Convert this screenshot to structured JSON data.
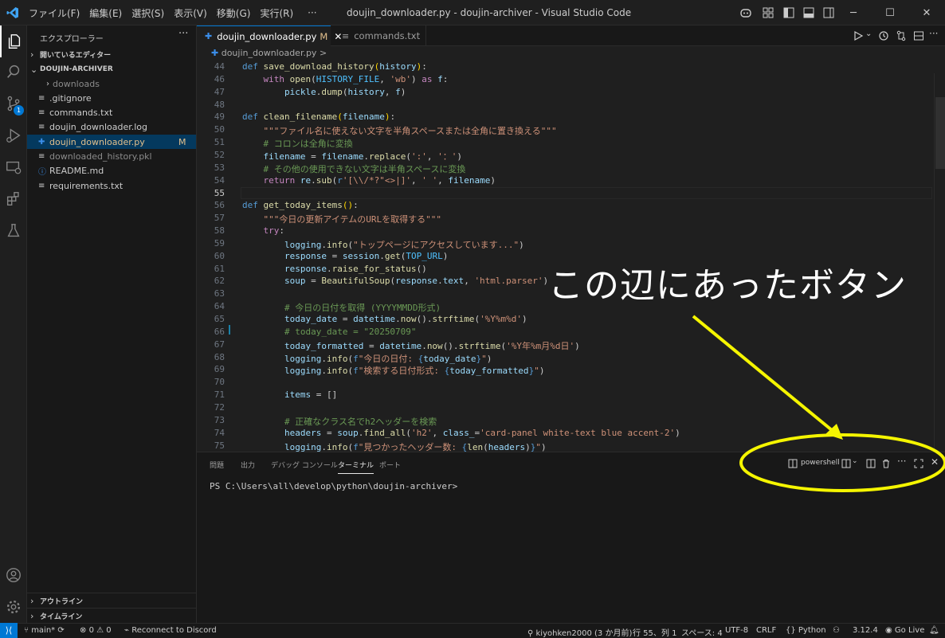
{
  "titlebar": {
    "menu": [
      "ファイル(F)",
      "編集(E)",
      "選択(S)",
      "表示(V)",
      "移動(G)",
      "実行(R)",
      "···"
    ],
    "window_title": "doujin_downloader.py - doujin-archiver - Visual Studio Code"
  },
  "sidebar": {
    "header": "エクスプローラー",
    "open_editors": "開いているエディター",
    "project": "DOUJIN-ARCHIVER",
    "items": [
      {
        "label": "downloads",
        "type": "folder"
      },
      {
        "label": ".gitignore",
        "type": "file"
      },
      {
        "label": "commands.txt",
        "type": "file"
      },
      {
        "label": "doujin_downloader.log",
        "type": "file"
      },
      {
        "label": "doujin_downloader.py",
        "type": "python",
        "selected": true,
        "badge": "M"
      },
      {
        "label": "downloaded_history.pkl",
        "type": "file"
      },
      {
        "label": "README.md",
        "type": "info"
      },
      {
        "label": "requirements.txt",
        "type": "file"
      }
    ],
    "outline": "アウトライン",
    "timeline": "タイムライン"
  },
  "scm_badge": "1",
  "tabs": [
    {
      "label": "doujin_downloader.py",
      "modified": "M",
      "active": true
    },
    {
      "label": "commands.txt",
      "active": false
    }
  ],
  "breadcrumb": "doujin_downloader.py >",
  "code_lines": [
    {
      "n": "44",
      "html": "<span class='k'>def</span> <span class='f'>save_download_history</span><span class='p'>(</span><span class='v'>history</span><span class='p'>)</span>:"
    },
    {
      "n": "46",
      "html": "    <span class='c'>with</span> <span class='f'>open</span>(<span class='n'>HISTORY_FILE</span>, <span class='s'>'wb'</span>) <span class='c'>as</span> <span class='v'>f</span>:"
    },
    {
      "n": "47",
      "html": "        <span class='v'>pickle</span>.<span class='f'>dump</span>(<span class='v'>history</span>, <span class='v'>f</span>)"
    },
    {
      "n": "48",
      "html": ""
    },
    {
      "n": "49",
      "html": "<span class='k'>def</span> <span class='f'>clean_filename</span><span class='p'>(</span><span class='v'>filename</span><span class='p'>)</span>:"
    },
    {
      "n": "50",
      "html": "    <span class='s'>\"\"\"ファイル名に使えない文字を半角スペースまたは全角に置き換える\"\"\"</span>"
    },
    {
      "n": "51",
      "html": "    <span class='cm'># コロンは全角に変換</span>"
    },
    {
      "n": "52",
      "html": "    <span class='v'>filename</span> = <span class='v'>filename</span>.<span class='f'>replace</span>(<span class='s'>':'</span>, <span class='s'>'：'</span>)"
    },
    {
      "n": "53",
      "html": "    <span class='cm'># その他の使用できない文字は半角スペースに変換</span>"
    },
    {
      "n": "54",
      "html": "    <span class='c'>return</span> <span class='v'>re</span>.<span class='f'>sub</span>(<span class='k'>r</span><span class='s'>'[\\\\/*?\"&lt;&gt;|]'</span>, <span class='s'>' '</span>, <span class='v'>filename</span>)"
    },
    {
      "n": "55",
      "html": "",
      "current": true
    },
    {
      "n": "56",
      "html": "<span class='k'>def</span> <span class='f'>get_today_items</span><span class='p'>()</span>:"
    },
    {
      "n": "57",
      "html": "    <span class='s'>\"\"\"今日の更新アイテムのURLを取得する\"\"\"</span>"
    },
    {
      "n": "58",
      "html": "    <span class='c'>try</span>:"
    },
    {
      "n": "59",
      "html": "        <span class='v'>logging</span>.<span class='f'>info</span>(<span class='s'>\"トップページにアクセスしています...\"</span>)"
    },
    {
      "n": "60",
      "html": "        <span class='v'>response</span> = <span class='v'>session</span>.<span class='f'>get</span>(<span class='n'>TOP_URL</span>)"
    },
    {
      "n": "61",
      "html": "        <span class='v'>response</span>.<span class='f'>raise_for_status</span>()"
    },
    {
      "n": "62",
      "html": "        <span class='v'>soup</span> = <span class='f'>BeautifulSoup</span>(<span class='v'>response</span>.<span class='v'>text</span>, <span class='s'>'html.parser'</span>)"
    },
    {
      "n": "63",
      "html": ""
    },
    {
      "n": "64",
      "html": "        <span class='cm'># 今日の日付を取得 (YYYYMMDD形式)</span>"
    },
    {
      "n": "65",
      "html": "        <span class='v'>today_date</span> = <span class='v'>datetime</span>.<span class='f'>now</span>().<span class='f'>strftime</span>(<span class='s'>'%Y%m%d'</span>)"
    },
    {
      "n": "66",
      "html": "        <span class='cm'># today_date = \"20250709\"</span>"
    },
    {
      "n": "67",
      "html": "        <span class='v'>today_formatted</span> = <span class='v'>datetime</span>.<span class='f'>now</span>().<span class='f'>strftime</span>(<span class='s'>'%Y年%m月%d日'</span>)"
    },
    {
      "n": "68",
      "html": "        <span class='v'>logging</span>.<span class='f'>info</span>(<span class='k'>f</span><span class='s'>\"今日の日付: </span><span class='k'>{</span><span class='v'>today_date</span><span class='k'>}</span><span class='s'>\"</span>)"
    },
    {
      "n": "69",
      "html": "        <span class='v'>logging</span>.<span class='f'>info</span>(<span class='k'>f</span><span class='s'>\"検索する日付形式: </span><span class='k'>{</span><span class='v'>today_formatted</span><span class='k'>}</span><span class='s'>\"</span>)"
    },
    {
      "n": "70",
      "html": ""
    },
    {
      "n": "71",
      "html": "        <span class='v'>items</span> = []"
    },
    {
      "n": "72",
      "html": ""
    },
    {
      "n": "73",
      "html": "        <span class='cm'># 正確なクラス名でh2ヘッダーを検索</span>"
    },
    {
      "n": "74",
      "html": "        <span class='v'>headers</span> = <span class='v'>soup</span>.<span class='f'>find_all</span>(<span class='s'>'h2'</span>, <span class='v'>class_</span>=<span class='s'>'card-panel white-text blue accent-2'</span>)"
    },
    {
      "n": "75",
      "html": "        <span class='v'>logging</span>.<span class='f'>info</span>(<span class='k'>f</span><span class='s'>\"見つかったヘッダー数: </span><span class='k'>{</span><span class='f'>len</span>(<span class='v'>headers</span>)<span class='k'>}</span><span class='s'>\"</span>)"
    }
  ],
  "panel": {
    "tabs": [
      "問題",
      "出力",
      "デバッグ コンソール",
      "ターミナル",
      "ポート"
    ],
    "active_tab": "ターミナル",
    "shell_label": "powershell",
    "terminal_line": "PS C:\\Users\\all\\develop\\python\\doujin-archiver>"
  },
  "annotation": {
    "text": "この辺にあったボタン",
    "color": "#ffff00"
  },
  "statusbar": {
    "branch": "main*",
    "errors": "0",
    "warnings": "0",
    "discord": "Reconnect to Discord",
    "author": "kiyohken2000 (3 か月前)",
    "position": "行 55、列 1",
    "spaces": "スペース: 4",
    "encoding": "UTF-8",
    "eol": "CRLF",
    "language": "Python",
    "python_version": "3.12.4",
    "golive": "Go Live"
  }
}
